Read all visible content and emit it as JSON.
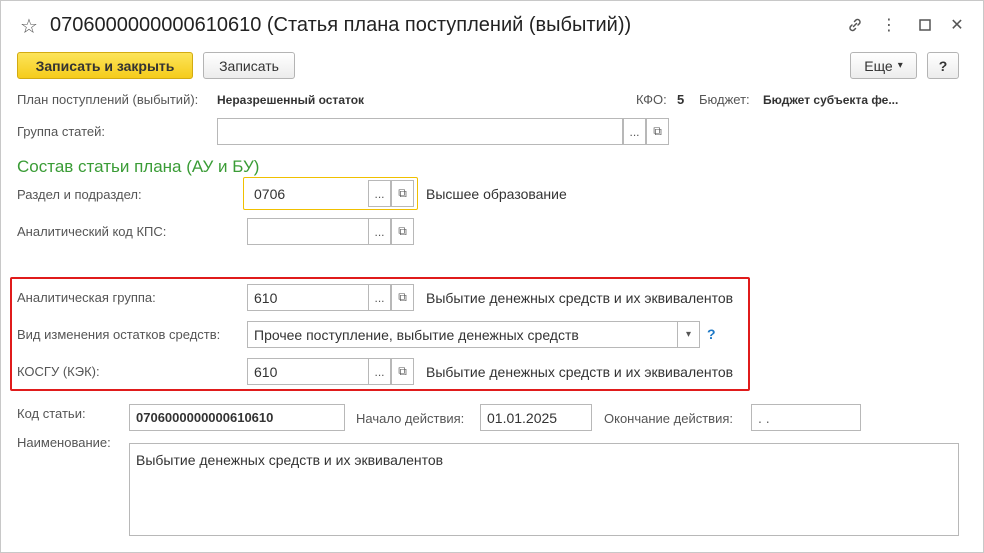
{
  "window": {
    "title": "0706000000000610610 (Статья плана поступлений (выбытий))",
    "star_icon": "☆",
    "link_icon": "🔗",
    "more_icon": "⋮",
    "maximize_icon": "☐",
    "close_icon": "✕"
  },
  "toolbar": {
    "save_close_label": "Записать и закрыть",
    "save_label": "Записать",
    "more_label": "Еще",
    "more_arrow": "▾",
    "help_label": "?"
  },
  "header_info": {
    "plan_label": "План поступлений (выбытий):",
    "plan_value": "Неразрешенный остаток",
    "kfo_label": "КФО:",
    "kfo_value": "5",
    "budget_label": "Бюджет:",
    "budget_value": "Бюджет субъекта фе..."
  },
  "group": {
    "label": "Группа статей:",
    "value": ""
  },
  "section": {
    "title": "Состав статьи плана (АУ и БУ)"
  },
  "fields": {
    "razdel": {
      "label": "Раздел и подраздел:",
      "value": "0706",
      "description": "Высшее образование"
    },
    "kps": {
      "label": "Аналитический код КПС:",
      "value": ""
    },
    "an_group": {
      "label": "Аналитическая группа:",
      "value": "610",
      "description": "Выбытие денежных средств и их эквивалентов"
    },
    "vid": {
      "label": "Вид изменения остатков средств:",
      "value": "Прочее поступление, выбытие денежных средств",
      "help": "?"
    },
    "kosgu": {
      "label": "КОСГУ (КЭК):",
      "value": "610",
      "description": "Выбытие денежных средств и их эквивалентов"
    }
  },
  "footer": {
    "code_label": "Код статьи:",
    "code_value": "0706000000000610610",
    "start_label": "Начало действия:",
    "start_value": "01.01.2025",
    "end_label": "Окончание действия:",
    "end_value": " .  .",
    "name_label": "Наименование:",
    "name_value": "Выбытие денежных средств и их эквивалентов"
  },
  "buttons": {
    "select": "...",
    "open": "⧉",
    "dropdown": "▾"
  },
  "colors": {
    "accent_yellow": "#f5cc1b",
    "section_green": "#3a9c36",
    "highlight_red": "#e01b1b",
    "help_blue": "#1f79c6"
  }
}
